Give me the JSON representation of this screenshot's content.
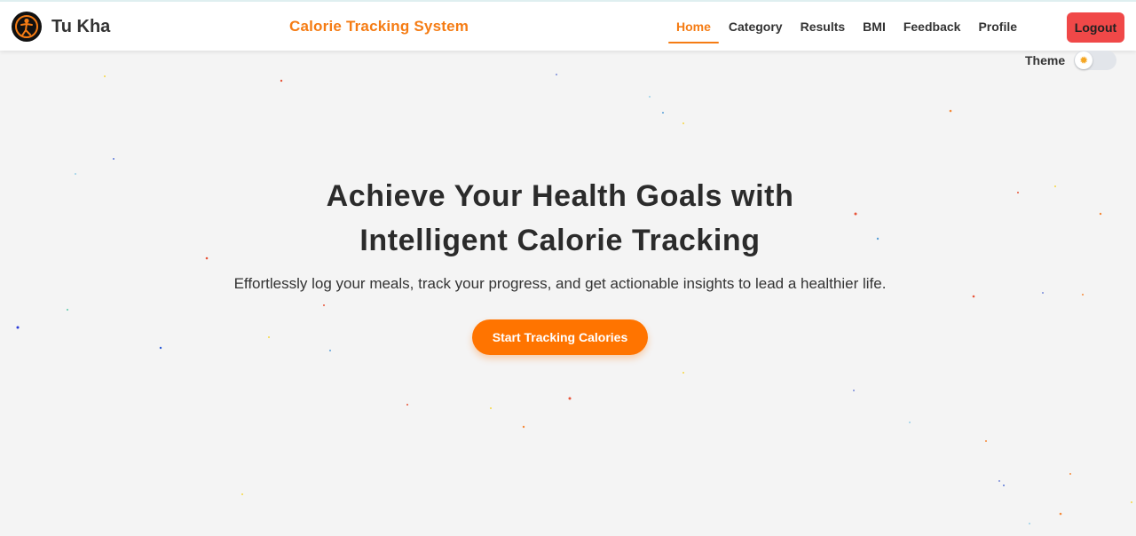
{
  "navbar": {
    "brand_name": "Tu Kha",
    "app_title": "Calorie Tracking System",
    "links": [
      {
        "label": "Home",
        "active": true
      },
      {
        "label": "Category",
        "active": false
      },
      {
        "label": "Results",
        "active": false
      },
      {
        "label": "BMI",
        "active": false
      },
      {
        "label": "Feedback",
        "active": false
      },
      {
        "label": "Profile",
        "active": false
      }
    ],
    "logout_label": "Logout"
  },
  "theme": {
    "label": "Theme",
    "icon": "sun-icon",
    "enabled": false
  },
  "hero": {
    "title_line1": "Achieve Your Health Goals with",
    "title_line2": "Intelligent Calorie Tracking",
    "subtitle": "Effortlessly log your meals, track your progress, and get actionable insights to lead a healthier life.",
    "cta_label": "Start Tracking Calories"
  },
  "colors": {
    "accent": "#f57c14",
    "cta": "#ff7400",
    "logout": "#f04848",
    "background": "#f4f4f4"
  }
}
